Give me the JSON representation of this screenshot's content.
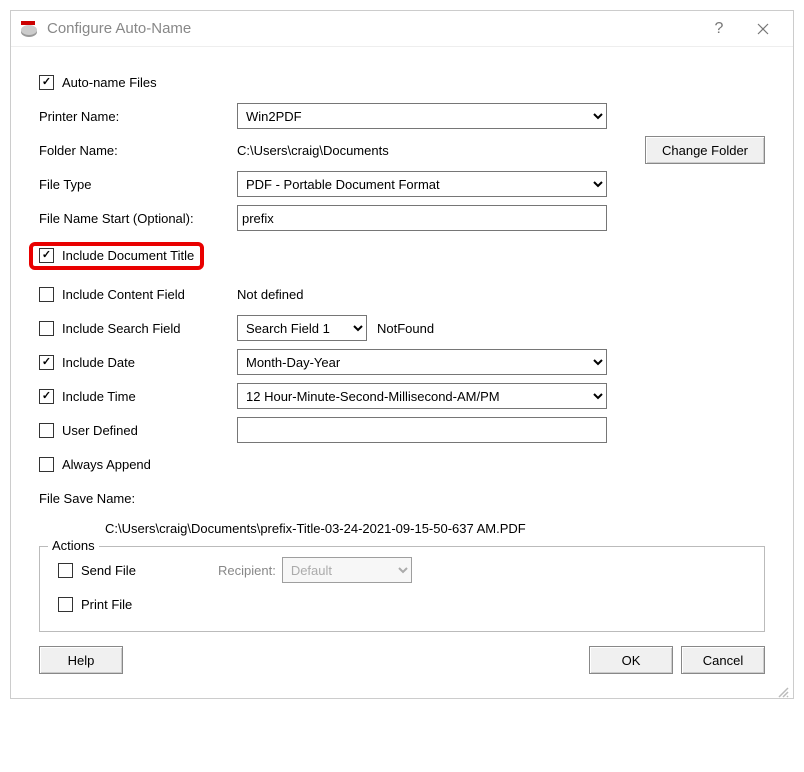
{
  "titlebar": {
    "title": "Configure Auto-Name"
  },
  "autoNameFiles": {
    "label": "Auto-name Files",
    "checked": true
  },
  "printerName": {
    "label": "Printer Name:",
    "value": "Win2PDF"
  },
  "folderName": {
    "label": "Folder Name:",
    "value": "C:\\Users\\craig\\Documents",
    "button": "Change Folder"
  },
  "fileType": {
    "label": "File Type",
    "value": "PDF - Portable Document Format"
  },
  "fileNameStart": {
    "label": "File Name Start (Optional):",
    "value": "prefix"
  },
  "includeDocTitle": {
    "label": "Include Document Title",
    "checked": true
  },
  "includeContentField": {
    "label": "Include Content Field",
    "checked": false,
    "status": "Not defined"
  },
  "includeSearchField": {
    "label": "Include Search Field",
    "checked": false,
    "selectValue": "Search Field 1",
    "status": "NotFound"
  },
  "includeDate": {
    "label": "Include Date",
    "checked": true,
    "value": "Month-Day-Year"
  },
  "includeTime": {
    "label": "Include Time",
    "checked": true,
    "value": "12 Hour-Minute-Second-Millisecond-AM/PM"
  },
  "userDefined": {
    "label": "User Defined",
    "checked": false,
    "value": ""
  },
  "alwaysAppend": {
    "label": "Always Append",
    "checked": false
  },
  "fileSaveName": {
    "label": "File Save Name:",
    "preview": "C:\\Users\\craig\\Documents\\prefix-Title-03-24-2021-09-15-50-637 AM.PDF"
  },
  "actions": {
    "legend": "Actions",
    "sendFile": {
      "label": "Send File",
      "checked": false
    },
    "recipientLabel": "Recipient:",
    "recipientValue": "Default",
    "printFile": {
      "label": "Print File",
      "checked": false
    }
  },
  "buttons": {
    "help": "Help",
    "ok": "OK",
    "cancel": "Cancel"
  }
}
